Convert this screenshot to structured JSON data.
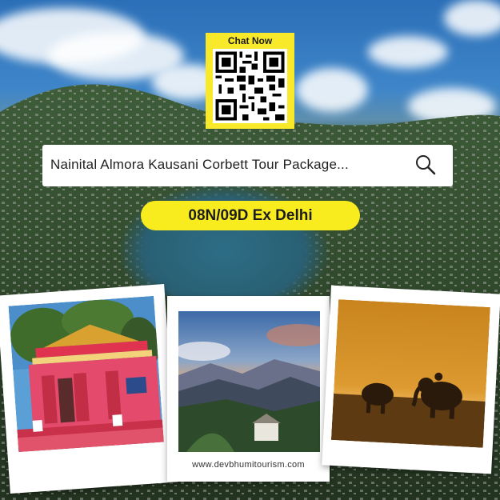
{
  "qr": {
    "title": "Chat Now",
    "icon": "qr-code-icon"
  },
  "search": {
    "value": "Nainital Almora Kausani Corbett Tour Package...",
    "icon": "search-icon"
  },
  "badge": {
    "label": "08N/09D Ex Delhi"
  },
  "photos": [
    {
      "name": "temple-photo"
    },
    {
      "name": "sunset-mountains-photo",
      "caption": "www.devbhumitourism.com"
    },
    {
      "name": "elephants-photo"
    }
  ],
  "colors": {
    "accent": "#f8ec1f",
    "sky": "#2b6fb8",
    "forest": "#2e4a2c",
    "lake": "#2a5f73"
  }
}
